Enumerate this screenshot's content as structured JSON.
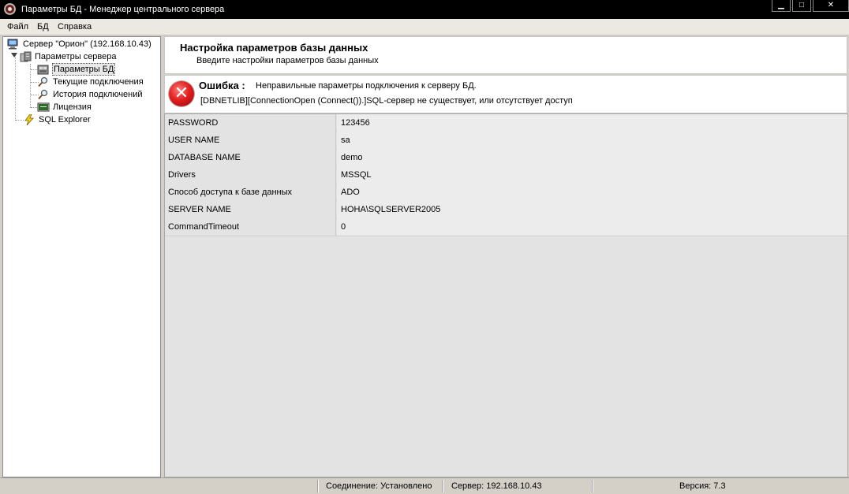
{
  "window": {
    "title": "Параметры БД - Менеджер центрального сервера",
    "minimize_label": "▁",
    "maximize_label": "□",
    "close_label": "✕"
  },
  "menu": [
    "Файл",
    "БД",
    "Справка"
  ],
  "tree": {
    "items": [
      {
        "label": "Сервер \"Орион\" (192.168.10.43)",
        "icon": "server-computer-icon"
      },
      {
        "label": "Параметры сервера",
        "icon": "server-settings-icon"
      },
      {
        "label": "Параметры БД",
        "icon": "database-icon",
        "selected": true
      },
      {
        "label": "Текущие подключения",
        "icon": "magnifier-icon"
      },
      {
        "label": "История подключений",
        "icon": "magnifier-icon"
      },
      {
        "label": "Лицензия",
        "icon": "license-icon"
      },
      {
        "label": "SQL Explorer",
        "icon": "lightning-icon"
      }
    ]
  },
  "header": {
    "title": "Настройка параметров базы данных",
    "subtitle": "Введите настройки параметров базы данных"
  },
  "error": {
    "label": "Ошибка :",
    "message": "Неправильные параметры подключения к серверу БД.",
    "detail": "[DBNETLIB][ConnectionOpen (Connect()).]SQL-сервер не существует, или отсутствует доступ"
  },
  "grid": {
    "rows": [
      {
        "name": "PASSWORD",
        "value": "123456"
      },
      {
        "name": "USER NAME",
        "value": "sa"
      },
      {
        "name": "DATABASE NAME",
        "value": "demo"
      },
      {
        "name": "Drivers",
        "value": "MSSQL"
      },
      {
        "name": "Способ доступа к базе данных",
        "value": "ADO"
      },
      {
        "name": "SERVER NAME",
        "value": "HOHA\\SQLSERVER2005"
      },
      {
        "name": "CommandTimeout",
        "value": "0"
      }
    ]
  },
  "status": {
    "connection": "Соединение: Установлено",
    "server": "Сервер: 192.168.10.43",
    "version": "Версия: 7.3"
  }
}
